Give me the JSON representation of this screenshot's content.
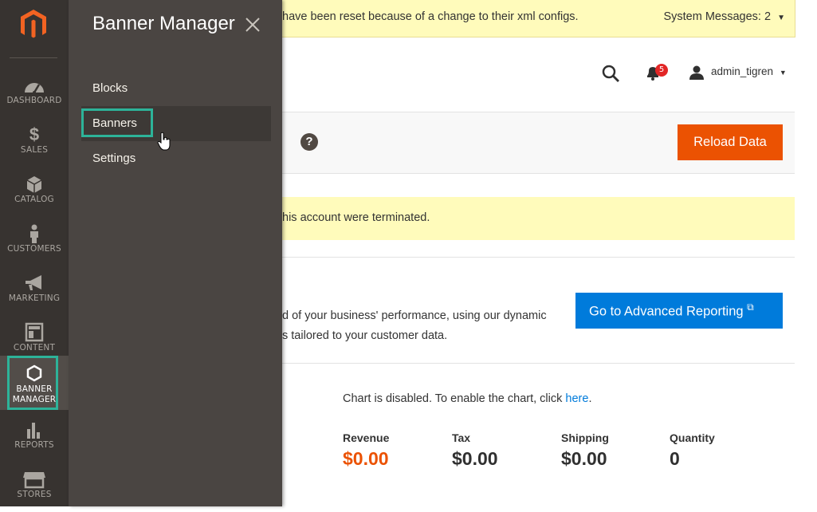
{
  "sidebar": {
    "logo": "magento-logo-icon",
    "items": [
      {
        "label": "DASHBOARD",
        "icon": "dashboard-gauge-icon"
      },
      {
        "label": "SALES",
        "icon": "dollar-icon"
      },
      {
        "label": "CATALOG",
        "icon": "box-icon"
      },
      {
        "label": "CUSTOMERS",
        "icon": "person-icon"
      },
      {
        "label": "MARKETING",
        "icon": "megaphone-icon"
      },
      {
        "label": "CONTENT",
        "icon": "layout-icon"
      },
      {
        "label": "BANNER\nMANAGER",
        "icon": "hexagon-icon",
        "active": true
      },
      {
        "label": "REPORTS",
        "icon": "bar-chart-icon"
      },
      {
        "label": "STORES",
        "icon": "storefront-icon"
      }
    ]
  },
  "submenu": {
    "title": "Banner Manager",
    "items": [
      {
        "label": "Blocks"
      },
      {
        "label": "Banners",
        "hovered": true
      },
      {
        "label": "Settings"
      }
    ]
  },
  "system_message": {
    "text": "have been reset because of a change to their xml configs.",
    "counter": "System Messages: 2"
  },
  "header": {
    "notification_count": "5",
    "username": "admin_tigren"
  },
  "page_actions": {
    "reload_label": "Reload Data"
  },
  "warning": {
    "text": "his account were terminated."
  },
  "advanced_reporting": {
    "line1": "d of your business' performance, using our dynamic",
    "line2": "s tailored to your customer data.",
    "button_label": "Go to Advanced Reporting"
  },
  "chart": {
    "note_prefix": "Chart is disabled. To enable the chart, click ",
    "note_link": "here",
    "note_suffix": "."
  },
  "totals": [
    {
      "label": "Revenue",
      "value": "$0.00"
    },
    {
      "label": "Tax",
      "value": "$0.00"
    },
    {
      "label": "Shipping",
      "value": "$0.00"
    },
    {
      "label": "Quantity",
      "value": "0"
    }
  ],
  "colors": {
    "rail": "#373330",
    "panel": "#4a4542",
    "accent_orange": "#eb5202",
    "accent_blue": "#007bdb",
    "highlight_teal": "#2db399",
    "message_yellow": "#fffbbb"
  }
}
